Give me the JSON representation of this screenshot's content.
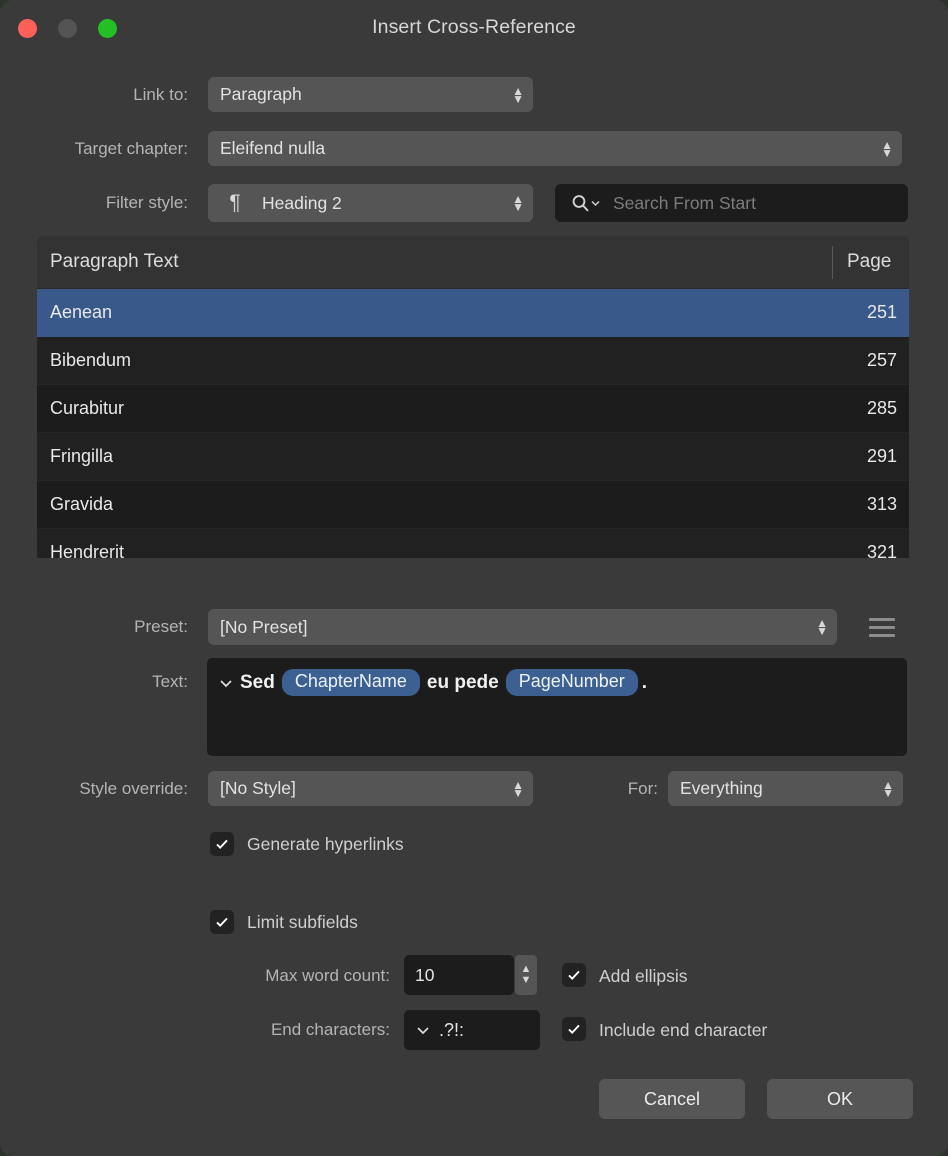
{
  "window": {
    "title": "Insert Cross-Reference",
    "traffic_lights": [
      "close-red",
      "minimize-gray",
      "maximize-green"
    ],
    "colors": {
      "window_bg": "#3a3a3a",
      "field_bg": "#1c1c1c",
      "popup_bg": "#555555",
      "accent_selection": "#39598a",
      "token_blue": "#3c6091",
      "label_text": "#b4b4b4",
      "close": "#ff6159",
      "minimize": "#545454",
      "maximize": "#22c024"
    }
  },
  "form": {
    "link_to": {
      "label": "Link to:",
      "value": "Paragraph"
    },
    "target_chapter": {
      "label": "Target chapter:",
      "value": "Eleifend nulla"
    },
    "filter_style": {
      "label": "Filter style:",
      "value": "Heading 2",
      "icon": "pilcrow-icon"
    },
    "search": {
      "placeholder": "Search From Start",
      "value": "",
      "icon": "search-icon"
    },
    "preset": {
      "label": "Preset:",
      "value": "[No Preset]"
    },
    "preset_menu_icon": "hamburger-menu-icon",
    "text": {
      "label": "Text:",
      "prefix_icon": "chevron-down-icon"
    },
    "style_override": {
      "label": "Style override:",
      "value": "[No Style]"
    },
    "for": {
      "label": "For:",
      "value": "Everything"
    }
  },
  "text_preview": {
    "parts": [
      {
        "kind": "word",
        "value": "Sed"
      },
      {
        "kind": "token",
        "value": "ChapterName"
      },
      {
        "kind": "word",
        "value": "eu pede"
      },
      {
        "kind": "token",
        "value": "PageNumber"
      },
      {
        "kind": "word",
        "value": "."
      }
    ]
  },
  "table": {
    "columns": [
      "Paragraph Text",
      "Page"
    ],
    "rows": [
      {
        "text": "Aenean",
        "page": "251",
        "selected": true
      },
      {
        "text": "Bibendum",
        "page": "257",
        "selected": false
      },
      {
        "text": "Curabitur",
        "page": "285",
        "selected": false
      },
      {
        "text": "Fringilla",
        "page": "291",
        "selected": false
      },
      {
        "text": "Gravida",
        "page": "313",
        "selected": false
      },
      {
        "text": "Hendrerit",
        "page": "321",
        "selected": false
      }
    ]
  },
  "checkboxes": {
    "generate_hyperlinks": {
      "label": "Generate hyperlinks",
      "checked": true
    },
    "limit_subfields": {
      "label": "Limit subfields",
      "checked": true
    },
    "add_ellipsis": {
      "label": "Add ellipsis",
      "checked": true
    },
    "include_end_character": {
      "label": "Include end character",
      "checked": true
    }
  },
  "subfields": {
    "max_word_count": {
      "label": "Max word count:",
      "value": "10"
    },
    "end_characters": {
      "label": "End characters:",
      "value": ".?!:"
    }
  },
  "buttons": {
    "cancel": "Cancel",
    "ok": "OK"
  }
}
